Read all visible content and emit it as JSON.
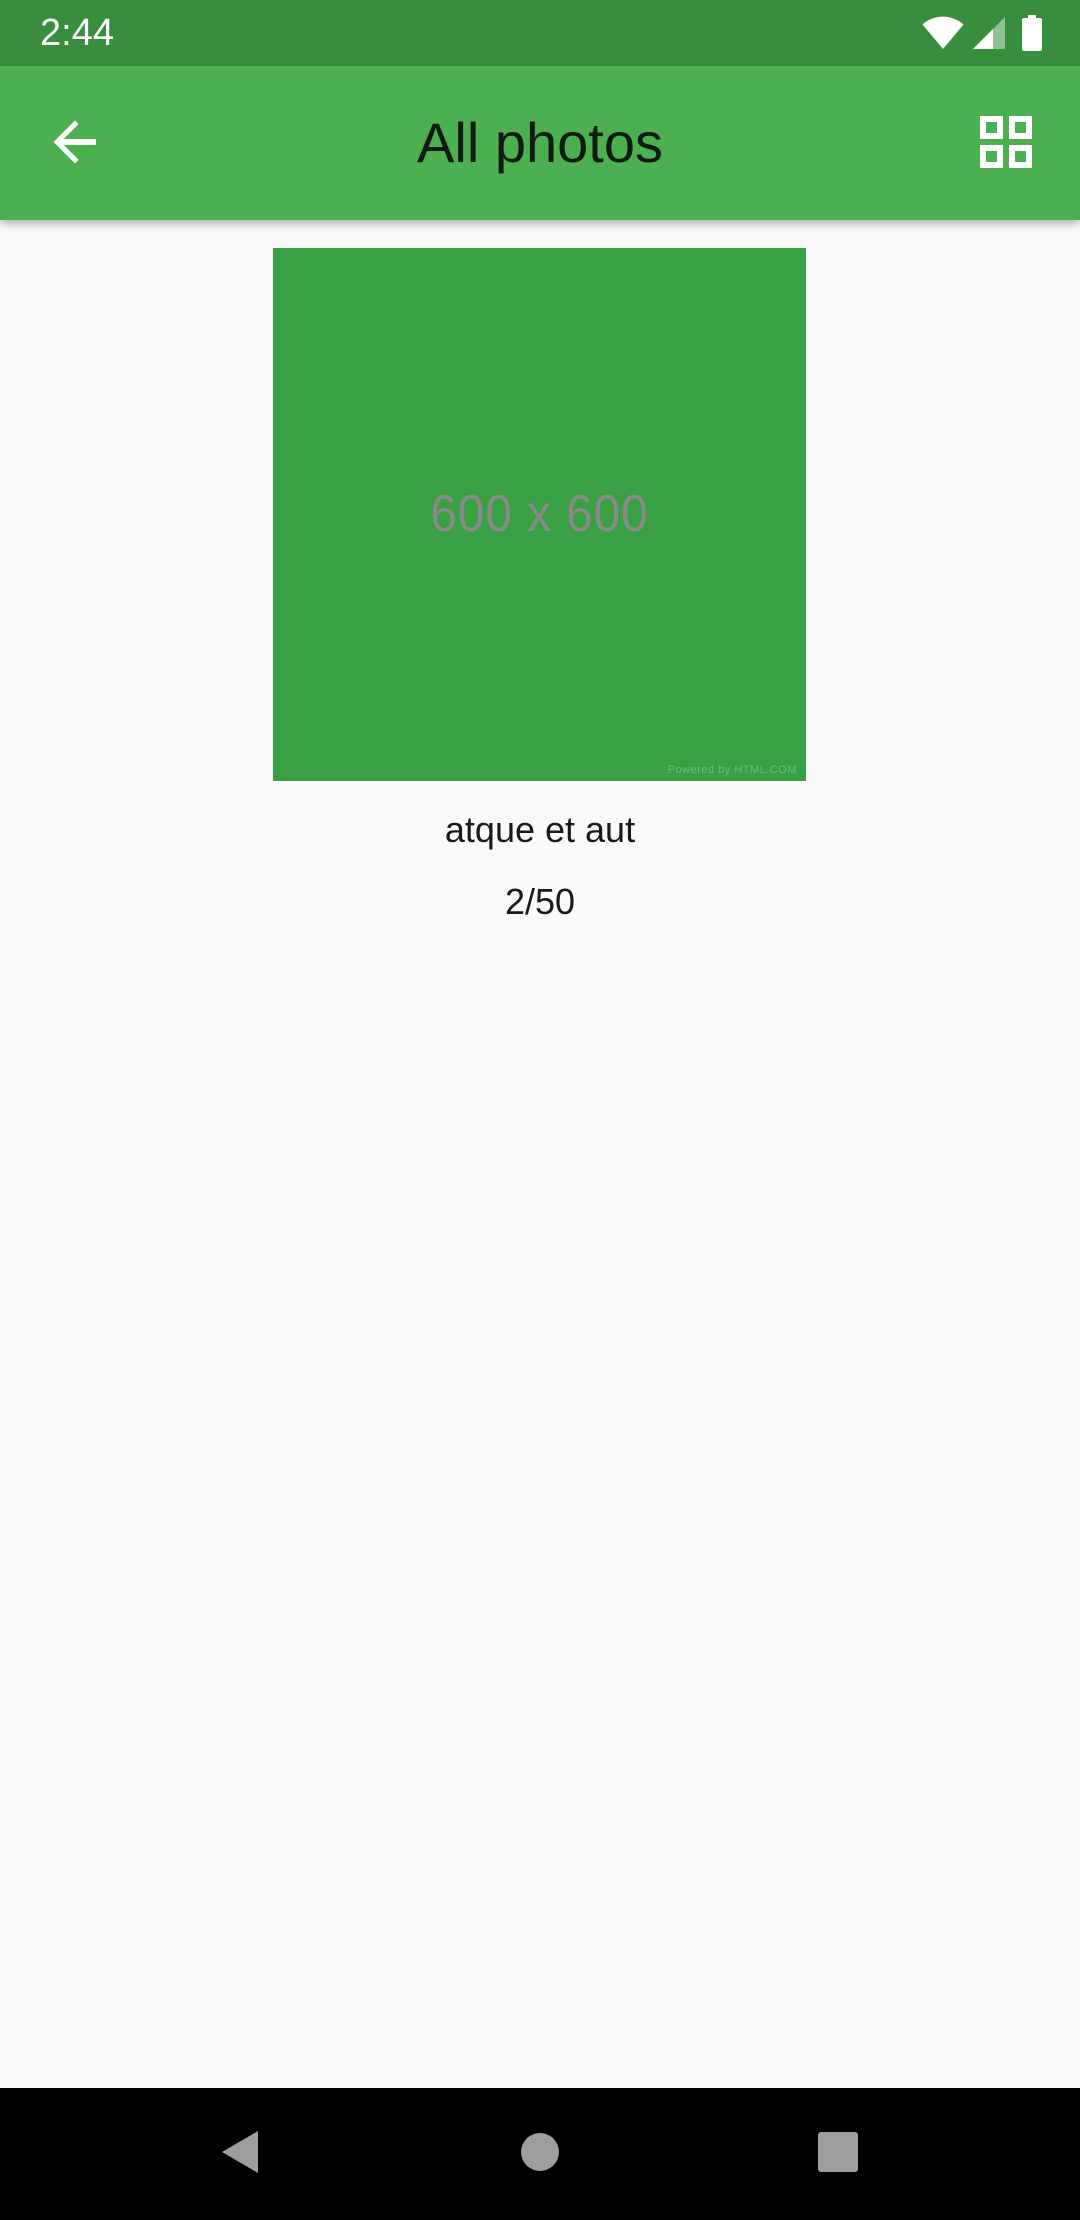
{
  "status_bar": {
    "time": "2:44",
    "icons": [
      "wifi-icon",
      "cell-signal-icon",
      "battery-icon"
    ]
  },
  "app_bar": {
    "title": "All photos",
    "back_icon": "arrow-back-icon",
    "action_icon": "grid-view-icon",
    "background_color": "#4caf50",
    "status_color": "#388e3c"
  },
  "photo": {
    "placeholder_text": "600 x 600",
    "watermark": "Powered by HTML.COM",
    "title": "atque et aut",
    "counter": "2/50",
    "color": "#389f43"
  },
  "nav_bar": {
    "buttons": [
      "nav-back-icon",
      "nav-home-icon",
      "nav-recents-icon"
    ]
  }
}
